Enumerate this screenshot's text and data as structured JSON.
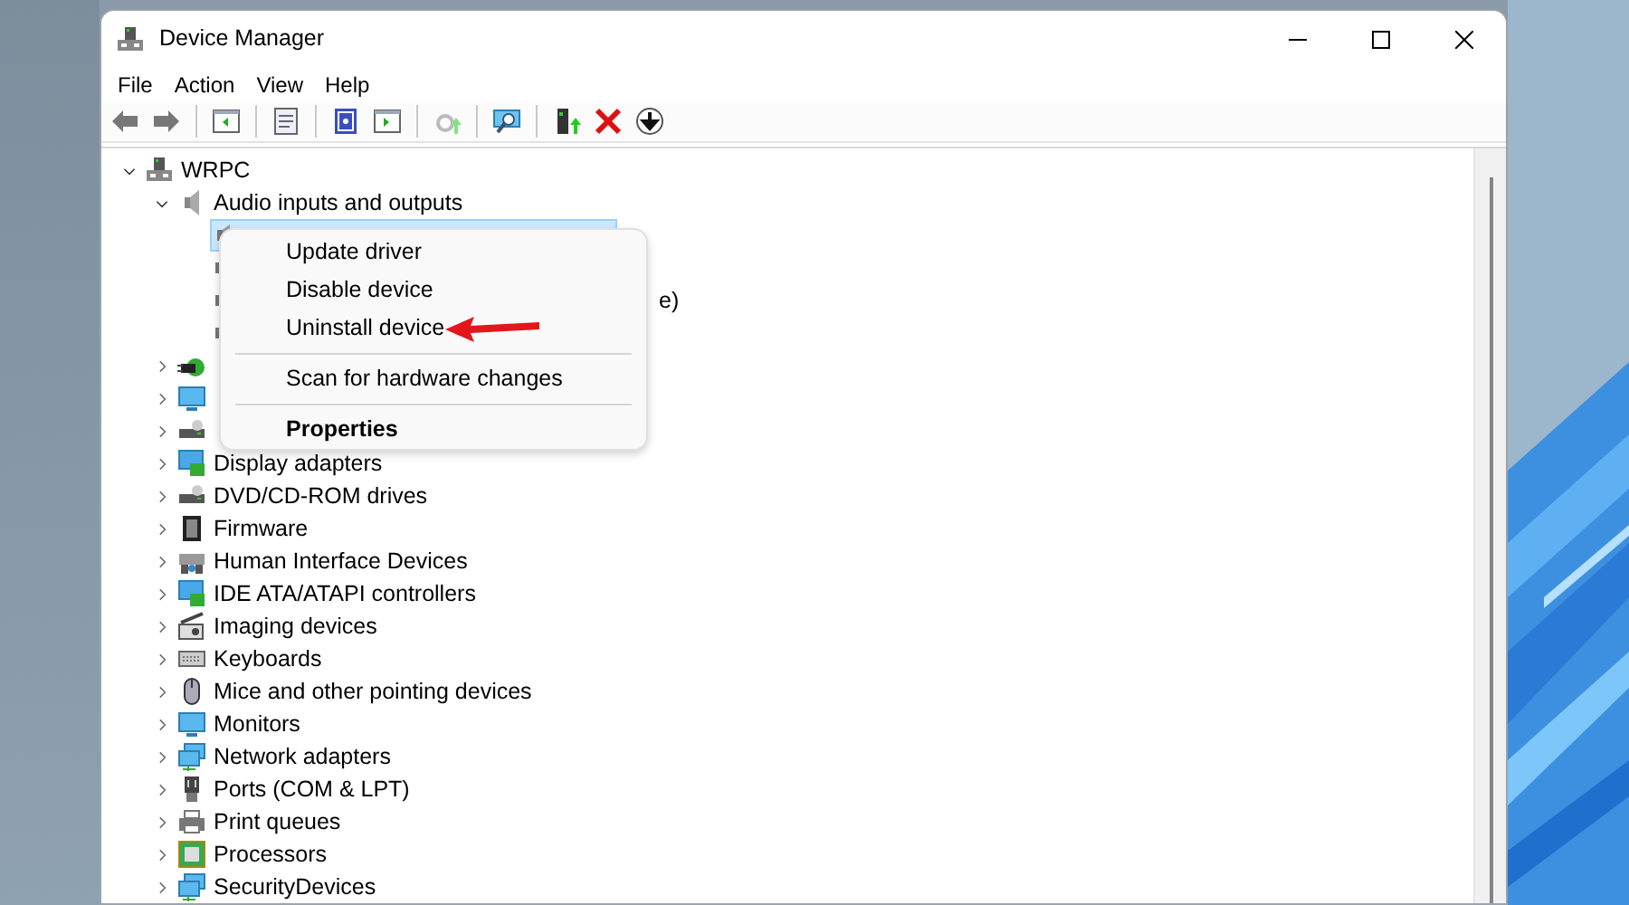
{
  "window": {
    "title": "Device Manager"
  },
  "menu": [
    "File",
    "Action",
    "View",
    "Help"
  ],
  "toolbar": [
    {
      "kind": "back",
      "disabled": false
    },
    {
      "kind": "forward",
      "disabled": false
    },
    {
      "kind": "sep"
    },
    {
      "kind": "tree",
      "disabled": false
    },
    {
      "kind": "sep"
    },
    {
      "kind": "props",
      "disabled": false
    },
    {
      "kind": "sep"
    },
    {
      "kind": "help",
      "disabled": false
    },
    {
      "kind": "pane",
      "disabled": false
    },
    {
      "kind": "sep"
    },
    {
      "kind": "update",
      "disabled": true
    },
    {
      "kind": "sep"
    },
    {
      "kind": "scan",
      "disabled": false
    },
    {
      "kind": "sep"
    },
    {
      "kind": "enable",
      "disabled": false
    },
    {
      "kind": "remove",
      "disabled": false
    },
    {
      "kind": "down",
      "disabled": false
    }
  ],
  "tree": [
    {
      "label": "WRPC",
      "kind": "computer",
      "expanded": true,
      "children": [
        {
          "label": "Audio inputs and outputs",
          "kind": "speaker",
          "expanded": true,
          "children": [
            {
              "kind": "audio",
              "selected": true
            },
            {
              "kind": "audio",
              "selected": false
            },
            {
              "kind": "audio",
              "label": "e)",
              "selected": false
            },
            {
              "kind": "audio",
              "selected": false
            }
          ]
        },
        {
          "kind": "plug",
          "expanded": false
        },
        {
          "kind": "monitor",
          "expanded": false
        },
        {
          "kind": "drive",
          "expanded": false
        },
        {
          "label": "Display adapters",
          "kind": "display",
          "expanded": false
        },
        {
          "label": "DVD/CD-ROM drives",
          "kind": "drive",
          "expanded": false
        },
        {
          "label": "Firmware",
          "kind": "chip",
          "expanded": false
        },
        {
          "label": "Human Interface Devices",
          "kind": "hid",
          "expanded": false
        },
        {
          "label": "IDE ATA/ATAPI controllers",
          "kind": "display",
          "expanded": false
        },
        {
          "label": "Imaging devices",
          "kind": "camera",
          "expanded": false
        },
        {
          "label": "Keyboards",
          "kind": "keyboard",
          "expanded": false
        },
        {
          "label": "Mice and other pointing devices",
          "kind": "mouse",
          "expanded": false
        },
        {
          "label": "Monitors",
          "kind": "monitor",
          "expanded": false
        },
        {
          "label": "Network adapters",
          "kind": "network",
          "expanded": false
        },
        {
          "label": "Ports (COM & LPT)",
          "kind": "port",
          "expanded": false
        },
        {
          "label": "Print queues",
          "kind": "printer",
          "expanded": false
        },
        {
          "label": "Processors",
          "kind": "processor",
          "expanded": false
        },
        {
          "label": "SecurityDevices",
          "kind": "network",
          "expanded": false
        }
      ]
    }
  ],
  "context_menu": [
    {
      "kind": "item",
      "label": "Update driver",
      "bold": false
    },
    {
      "kind": "item",
      "label": "Disable device",
      "bold": false
    },
    {
      "kind": "item",
      "label": "Uninstall device",
      "bold": false,
      "pointer": true
    },
    {
      "kind": "separator"
    },
    {
      "kind": "item",
      "label": "Scan for hardware changes",
      "bold": false
    },
    {
      "kind": "separator"
    },
    {
      "kind": "item",
      "label": "Properties",
      "bold": true
    }
  ]
}
